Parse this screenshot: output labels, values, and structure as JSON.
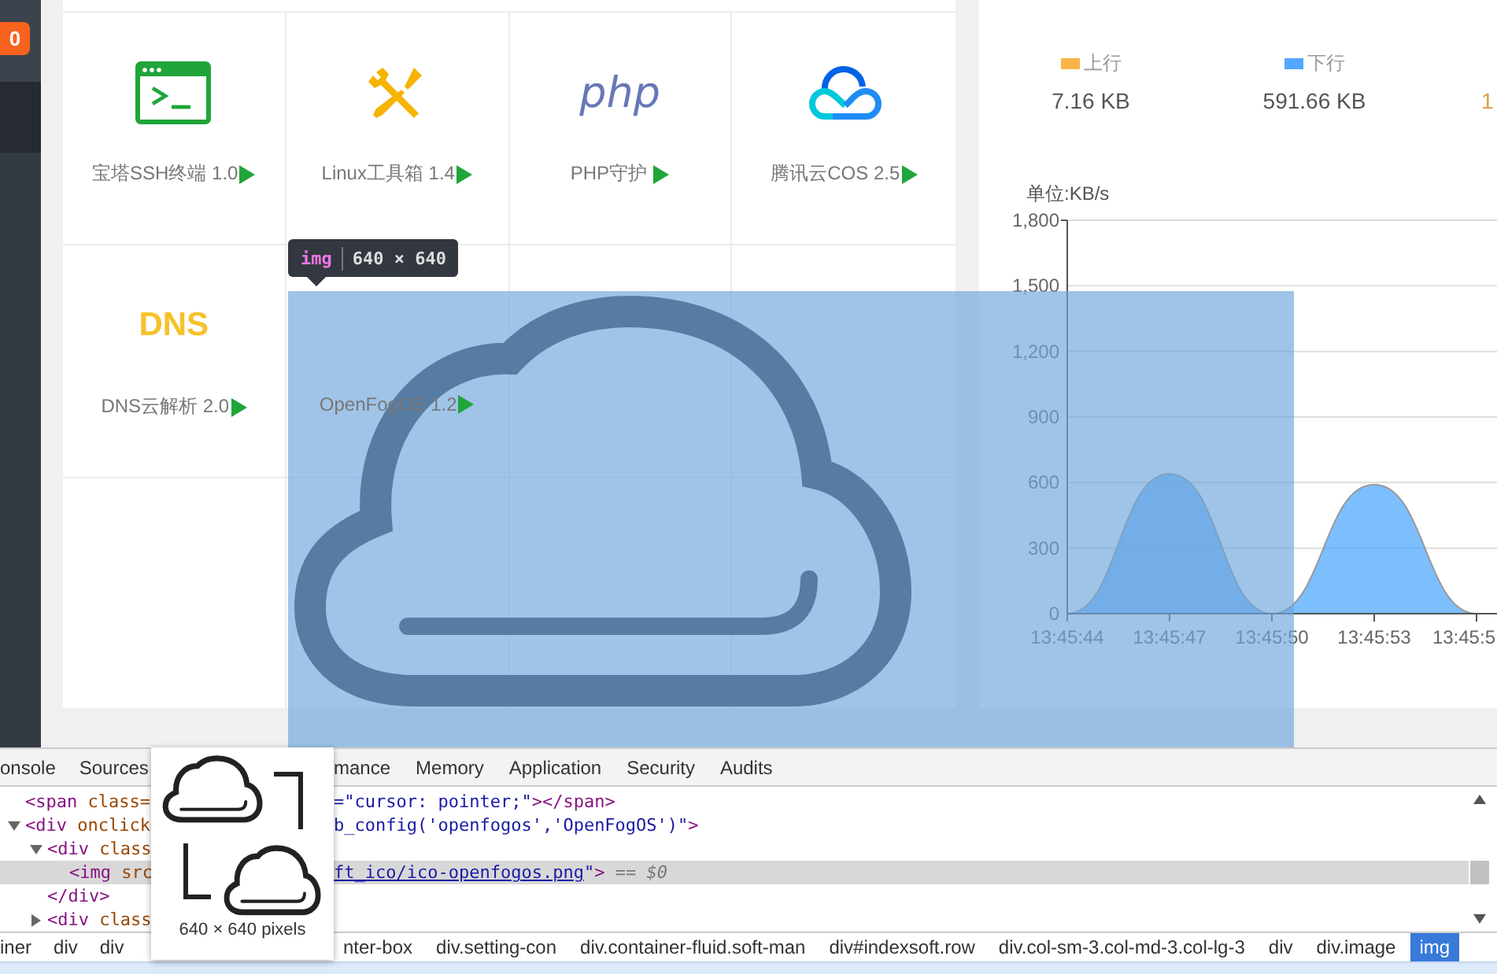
{
  "sidebar": {
    "badge": "0"
  },
  "soft_panel": {
    "items": [
      {
        "logo": {
          "kind": "terminal"
        },
        "label": "宝塔SSH终端 1.0"
      },
      {
        "logo": {
          "kind": "tools"
        },
        "label": "Linux工具箱 1.4"
      },
      {
        "logo": {
          "kind": "php",
          "text": "php"
        },
        "label": "PHP守护 "
      },
      {
        "logo": {
          "kind": "cloud"
        },
        "label": "腾讯云COS 2.5"
      },
      {
        "logo": {
          "kind": "dns",
          "text": "DNS"
        },
        "label": "DNS云解析 2.0"
      },
      {
        "logo": {
          "kind": "hidden"
        },
        "label": "OpenFogOS 1.2"
      }
    ]
  },
  "traffic_panel": {
    "stats": [
      {
        "label": "上行",
        "color": "#f9b54a",
        "value": "7.16 KB"
      },
      {
        "label": "下行",
        "color": "#52a8ff",
        "value": "591.66 KB"
      },
      {
        "value": "1"
      }
    ],
    "unit_label": "单位:KB/s",
    "chart_data": {
      "type": "area",
      "grid": true,
      "categories": [
        "13:45:44",
        "13:45:47",
        "13:45:50",
        "13:45:53",
        "13:45:5"
      ],
      "series": [
        {
          "color": "#52a8ff",
          "values": [
            0,
            640,
            0,
            590,
            0
          ]
        }
      ],
      "ylim": [
        0,
        1800
      ],
      "yticks": [
        {
          "value": 0,
          "label": "0"
        },
        {
          "value": 300,
          "label": "300"
        },
        {
          "value": 600,
          "label": "600"
        },
        {
          "value": 900,
          "label": "900"
        },
        {
          "value": 1200,
          "label": "1,200"
        },
        {
          "value": 1500,
          "label": "1,500"
        },
        {
          "value": 1800,
          "label": "1,800"
        }
      ]
    }
  },
  "inspect_tooltip": {
    "tag": "img",
    "size": "640 × 640"
  },
  "devtools": {
    "tabs_before_preview": [
      "onsole",
      "Sources"
    ],
    "tabs_after_preview": [
      "mance",
      "Memory",
      "Application",
      "Security",
      "Audits"
    ],
    "nodes": [
      {
        "selected": false,
        "left": [
          {
            "kind": "tag",
            "text": "<span"
          },
          {
            "kind": "attr",
            "text": " class="
          }
        ],
        "right": [
          {
            "kind": "value",
            "text": "=\"cursor: pointer;\""
          },
          {
            "kind": "tag",
            "text": "></span>"
          }
        ]
      },
      {
        "selected": false,
        "expanded": true,
        "left": [
          {
            "kind": "tag",
            "text": "<div"
          },
          {
            "kind": "attr",
            "text": " onclick"
          }
        ],
        "right": [
          {
            "kind": "value",
            "text": "b_config('openfogos','OpenFogOS')\""
          },
          {
            "kind": "tag",
            "text": ">"
          }
        ],
        "children": [
          {
            "selected": false,
            "expanded": true,
            "left": [
              {
                "kind": "tag",
                "text": "<div"
              },
              {
                "kind": "attr",
                "text": " class"
              }
            ],
            "closing": "</div>",
            "children": [
              {
                "selected": true,
                "left": [
                  {
                    "kind": "tag",
                    "text": "<img"
                  },
                  {
                    "kind": "attr",
                    "text": " src"
                  }
                ],
                "right": [
                  {
                    "kind": "link",
                    "text": "ft_ico/ico-openfogos.png"
                  },
                  {
                    "kind": "value",
                    "text": "\""
                  },
                  {
                    "kind": "tag",
                    "text": ">"
                  },
                  {
                    "kind": "note",
                    "text": " == $0"
                  }
                ]
              }
            ]
          },
          {
            "selected": false,
            "expanded": false,
            "left": [
              {
                "kind": "tag",
                "text": "<div"
              },
              {
                "kind": "attr",
                "text": " class"
              }
            ]
          }
        ]
      }
    ],
    "breadcrumbs_before_preview": [
      {
        "text": "iner",
        "selected": false
      },
      {
        "text": "div",
        "selected": false
      },
      {
        "text": "div",
        "selected": false
      }
    ],
    "breadcrumbs_after_preview": [
      {
        "text": "nter-box",
        "selected": false
      },
      {
        "text": "div.setting-con",
        "selected": false
      },
      {
        "text": "div.container-fluid.soft-man",
        "selected": false
      },
      {
        "text": "div#indexsoft.row",
        "selected": false
      },
      {
        "text": "div.col-sm-3.col-md-3.col-lg-3",
        "selected": false
      },
      {
        "text": "div",
        "selected": false
      },
      {
        "text": "div.image",
        "selected": false
      },
      {
        "text": "img",
        "selected": true
      }
    ]
  },
  "image_preview": {
    "caption": "640 × 640 pixels"
  }
}
